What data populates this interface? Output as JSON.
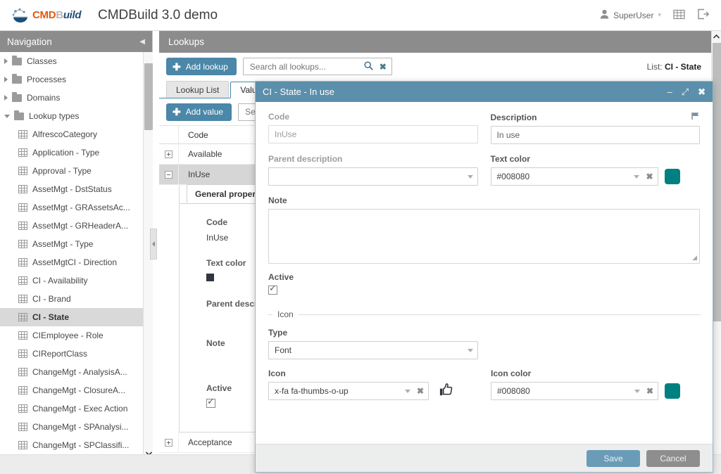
{
  "header": {
    "logo_cmd": "CMD",
    "logo_b": "B",
    "logo_uild": "uild",
    "app_title": "CMDBuild 3.0 demo",
    "user_name": "SuperUser",
    "user_icon": "user-icon",
    "grid_icon": "grid-icon",
    "logout_icon": "logout-icon",
    "caret_icon": "chevron-down-icon"
  },
  "navigation": {
    "title": "Navigation",
    "collapse_icon": "chevron-left-icon",
    "roots": [
      {
        "label": "Classes",
        "expanded": false
      },
      {
        "label": "Processes",
        "expanded": false
      },
      {
        "label": "Domains",
        "expanded": false
      },
      {
        "label": "Lookup types",
        "expanded": true
      }
    ],
    "items": [
      {
        "label": "AlfrescoCategory",
        "selected": false
      },
      {
        "label": "Application - Type",
        "selected": false
      },
      {
        "label": "Approval - Type",
        "selected": false
      },
      {
        "label": "AssetMgt - DstStatus",
        "selected": false
      },
      {
        "label": "AssetMgt - GRAssetsAc...",
        "selected": false
      },
      {
        "label": "AssetMgt - GRHeaderA...",
        "selected": false
      },
      {
        "label": "AssetMgt - Type",
        "selected": false
      },
      {
        "label": "AssetMgtCI - Direction",
        "selected": false
      },
      {
        "label": "CI - Availability",
        "selected": false
      },
      {
        "label": "CI - Brand",
        "selected": false
      },
      {
        "label": "CI - State",
        "selected": true
      },
      {
        "label": "CIEmployee - Role",
        "selected": false
      },
      {
        "label": "CIReportClass",
        "selected": false
      },
      {
        "label": "ChangeMgt - AnalysisA...",
        "selected": false
      },
      {
        "label": "ChangeMgt - ClosureA...",
        "selected": false
      },
      {
        "label": "ChangeMgt - Exec Action",
        "selected": false
      },
      {
        "label": "ChangeMgt - SPAnalysi...",
        "selected": false
      },
      {
        "label": "ChangeMgt - SPClassifi...",
        "selected": false
      }
    ]
  },
  "main": {
    "title": "Lookups",
    "add_lookup_label": "Add lookup",
    "search_placeholder": "Search all lookups...",
    "search_value": "",
    "search_icon": "search-icon",
    "clear_icon": "clear-icon",
    "list_prefix": "List:",
    "list_name": "CI - State",
    "tabs": [
      {
        "label": "Lookup List",
        "active": false
      },
      {
        "label": "Values",
        "active": true
      }
    ],
    "add_value_label": "Add value",
    "value_search_placeholder": "Search...",
    "grid": {
      "column_code": "Code",
      "rows": [
        {
          "code": "Available",
          "expanded": false,
          "selected": false
        },
        {
          "code": "InUse",
          "expanded": true,
          "selected": true
        },
        {
          "code": "Acceptance",
          "expanded": false,
          "selected": false
        }
      ]
    },
    "detail": {
      "tab_label": "General properties",
      "code_label": "Code",
      "code_value": "InUse",
      "text_color_label": "Text color",
      "text_color_value": "#2f3640",
      "parent_description_label": "Parent description",
      "note_label": "Note",
      "active_label": "Active",
      "active_checked": true
    }
  },
  "modal": {
    "title": "CI - State - In use",
    "minimize_icon": "minimize-icon",
    "maximize_icon": "maximize-icon",
    "close_icon": "close-icon",
    "code_label": "Code",
    "code_value": "InUse",
    "description_label": "Description",
    "description_value": "In use",
    "description_flag_icon": "flag-icon",
    "parent_description_label": "Parent description",
    "parent_description_value": "",
    "text_color_label": "Text color",
    "text_color_value": "#008080",
    "text_color_swatch": "#008080",
    "note_label": "Note",
    "note_value": "",
    "active_label": "Active",
    "active_checked": true,
    "icon_section_legend": "Icon",
    "type_label": "Type",
    "type_value": "Font",
    "icon_label": "Icon",
    "icon_value": "x-fa fa-thumbs-o-up",
    "icon_preview": "thumbs-up-icon",
    "icon_color_label": "Icon color",
    "icon_color_value": "#008080",
    "icon_color_swatch": "#008080",
    "save_label": "Save",
    "cancel_label": "Cancel",
    "caret_icon": "chevron-down-icon",
    "clear_icon": "clear-icon"
  },
  "scrollbars": {
    "up_icon": "chevron-up-icon",
    "down_icon": "chevron-down-icon"
  }
}
